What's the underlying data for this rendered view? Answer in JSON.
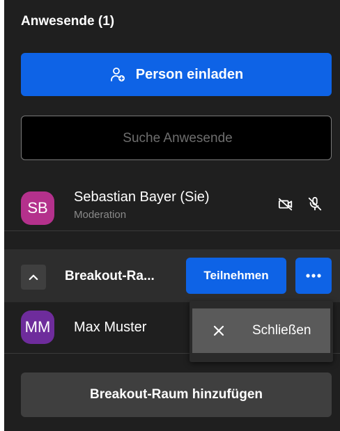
{
  "participants_panel": {
    "title": "Anwesende (1)",
    "invite_label": "Person einladen",
    "search_placeholder": "Suche Anwesende"
  },
  "participants": [
    {
      "initials": "SB",
      "name": "Sebastian Bayer (Sie)",
      "role": "Moderation",
      "avatar_color": "#b4318c",
      "icons": [
        "camera-off-icon",
        "microphone-off-icon"
      ]
    }
  ],
  "breakout_room": {
    "name": "Breakout-Ra...",
    "join_label": "Teilnehmen",
    "more_icon": "more-horizontal-icon",
    "members": [
      {
        "initials": "MM",
        "name": "Max Muster",
        "avatar_color": "#6e2c9c"
      }
    ],
    "menu": {
      "items": [
        {
          "label": "Schließen",
          "icon": "close-icon"
        }
      ]
    }
  },
  "add_room_label": "Breakout-Raum hinzufügen",
  "colors": {
    "panel_bg": "#1f1f1f",
    "primary": "#0e63e6",
    "secondary_button": "#3f3f3f",
    "muted_text": "#8a8a8a"
  }
}
